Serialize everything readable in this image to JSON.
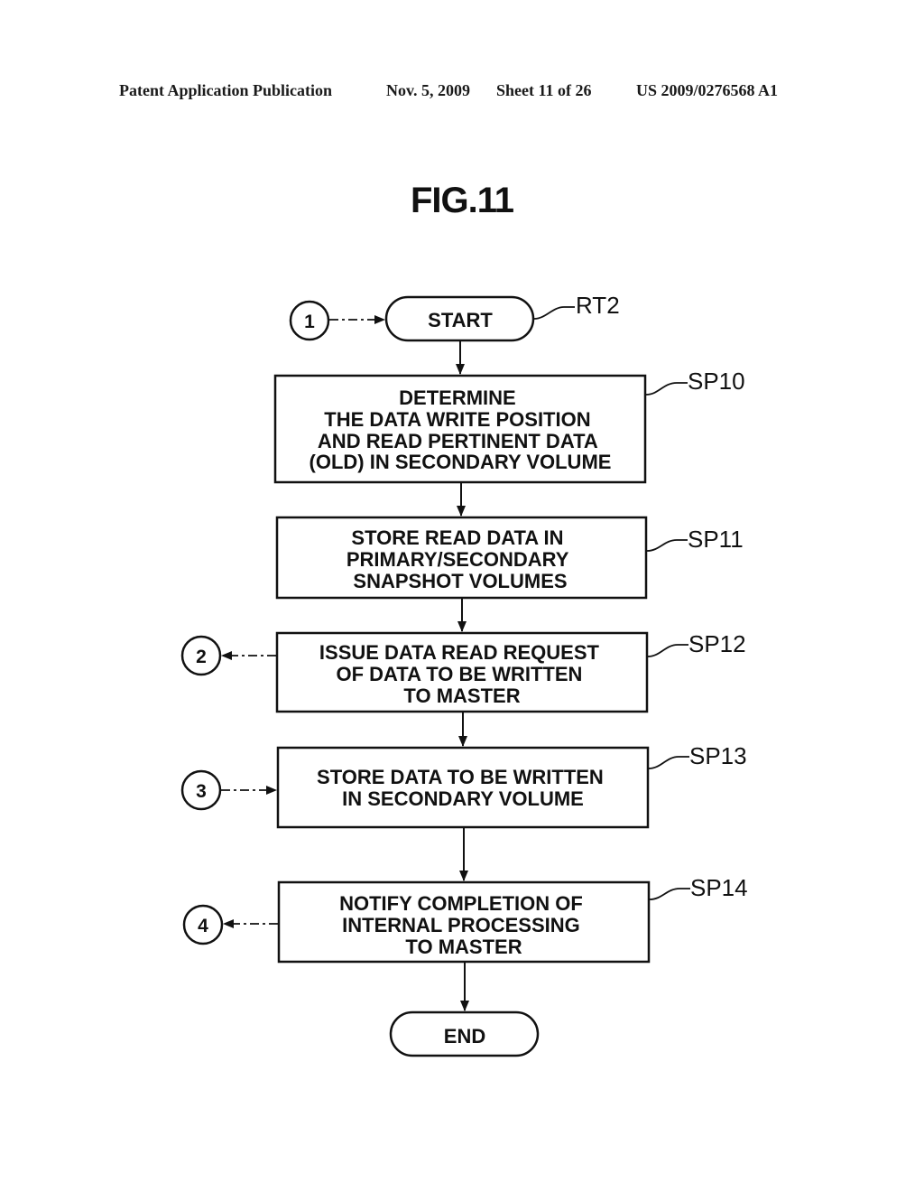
{
  "header": {
    "publication": "Patent Application Publication",
    "date": "Nov. 5, 2009",
    "sheet": "Sheet 11 of 26",
    "number": "US 2009/0276568 A1"
  },
  "figure": {
    "title": "FIG.11",
    "routine_label": "RT2"
  },
  "terminals": {
    "start": "START",
    "end": "END"
  },
  "steps": [
    {
      "id": "SP10",
      "lines": [
        "DETERMINE",
        "THE DATA WRITE POSITION",
        "AND READ PERTINENT DATA",
        "(OLD) IN SECONDARY VOLUME"
      ]
    },
    {
      "id": "SP11",
      "lines": [
        "STORE READ DATA IN",
        "PRIMARY/SECONDARY",
        "SNAPSHOT VOLUMES"
      ]
    },
    {
      "id": "SP12",
      "lines": [
        "ISSUE DATA READ REQUEST",
        "OF DATA TO BE WRITTEN",
        "TO MASTER"
      ]
    },
    {
      "id": "SP13",
      "lines": [
        "STORE DATA TO BE WRITTEN",
        "IN SECONDARY VOLUME"
      ]
    },
    {
      "id": "SP14",
      "lines": [
        "NOTIFY COMPLETION OF",
        "INTERNAL PROCESSING",
        "TO MASTER"
      ]
    }
  ],
  "connectors": [
    {
      "label": "1",
      "direction": "in",
      "target": "START"
    },
    {
      "label": "2",
      "direction": "out",
      "target": "SP12"
    },
    {
      "label": "3",
      "direction": "in",
      "target": "SP13"
    },
    {
      "label": "4",
      "direction": "out",
      "target": "SP14"
    }
  ]
}
